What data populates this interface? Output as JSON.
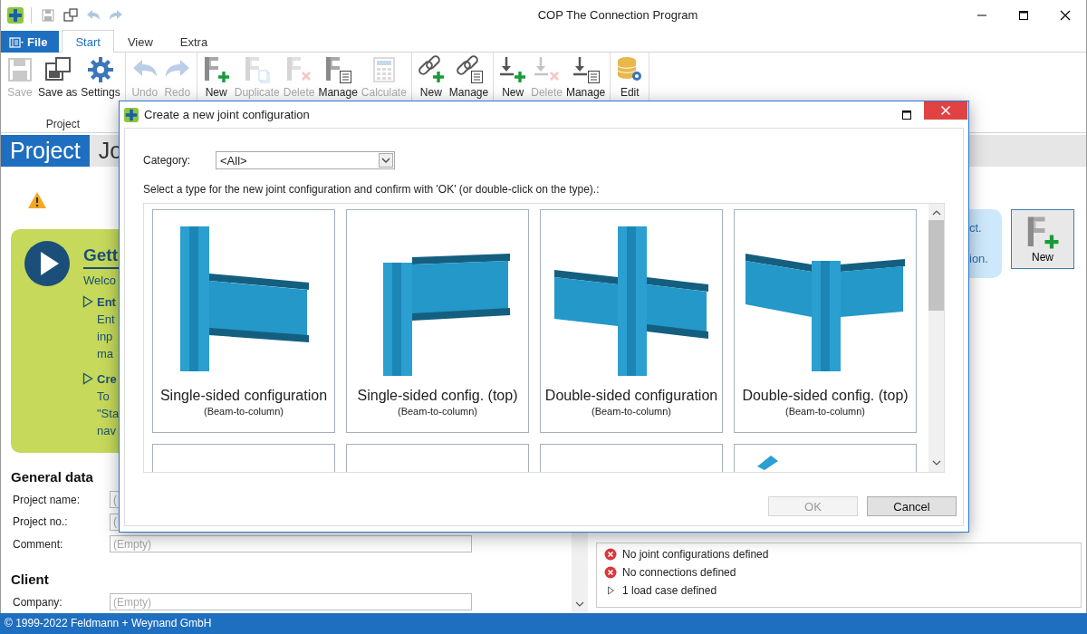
{
  "window": {
    "title": "COP The Connection Program"
  },
  "quick_access": [
    {
      "kind": "save",
      "disabled": true
    },
    {
      "kind": "save_as",
      "disabled": false
    },
    {
      "kind": "undo",
      "disabled": true
    },
    {
      "kind": "redo",
      "disabled": true
    }
  ],
  "menu_tabs": [
    {
      "label": "File",
      "kind": "file",
      "selected": false
    },
    {
      "label": "Start",
      "kind": "tab",
      "selected": true
    },
    {
      "label": "View",
      "kind": "tab",
      "selected": false
    },
    {
      "label": "Extra",
      "kind": "tab",
      "selected": false
    }
  ],
  "ribbon": {
    "groups": [
      {
        "label": "Project",
        "buttons": [
          {
            "label": "Save",
            "kind": "save",
            "disabled": true
          },
          {
            "label": "Save as",
            "kind": "save_as",
            "disabled": false
          },
          {
            "label": "Settings",
            "kind": "gear",
            "disabled": false
          }
        ]
      },
      {
        "buttons": [
          {
            "label": "Undo",
            "kind": "undo",
            "disabled": true
          },
          {
            "label": "Redo",
            "kind": "redo",
            "disabled": true
          }
        ]
      },
      {
        "buttons": [
          {
            "label": "New",
            "kind": "joint_new",
            "disabled": false
          },
          {
            "label": "Duplicate",
            "kind": "joint_dup",
            "disabled": true
          },
          {
            "label": "Delete",
            "kind": "joint_del",
            "disabled": true
          },
          {
            "label": "Manage",
            "kind": "joint_manage",
            "disabled": false
          },
          {
            "label": "Calculate",
            "kind": "calc",
            "disabled": true
          }
        ]
      },
      {
        "buttons": [
          {
            "label": "New",
            "kind": "link_new",
            "disabled": false
          },
          {
            "label": "Manage",
            "kind": "link_manage",
            "disabled": false
          }
        ]
      },
      {
        "buttons": [
          {
            "label": "New",
            "kind": "load_new",
            "disabled": false
          },
          {
            "label": "Delete",
            "kind": "load_del",
            "disabled": true
          },
          {
            "label": "Manage",
            "kind": "load_manage",
            "disabled": false
          }
        ]
      },
      {
        "buttons": [
          {
            "label": "Edit",
            "kind": "database",
            "disabled": false
          }
        ]
      }
    ]
  },
  "page_tabs": [
    {
      "label": "Project",
      "selected": true
    },
    {
      "label": "Jo",
      "selected": false
    }
  ],
  "getting_started": {
    "title": "Gett",
    "intro": "Welco",
    "items": [
      {
        "heading": "Ent",
        "lines": [
          "Ent",
          "inp",
          "ma"
        ]
      },
      {
        "heading": "Cre",
        "lines": [
          "To",
          "\"Sta",
          "nav"
        ]
      }
    ]
  },
  "general_data": {
    "title": "General data",
    "fields": [
      {
        "label": "Project name:",
        "placeholder": "("
      },
      {
        "label": "Project no.:",
        "placeholder": "("
      },
      {
        "label": "Comment:",
        "placeholder": "(Empty)"
      }
    ]
  },
  "client": {
    "title": "Client",
    "fields": [
      {
        "label": "Company:",
        "placeholder": "(Empty)"
      }
    ]
  },
  "info_card": {
    "lines": [
      "ct.",
      "ion."
    ]
  },
  "new_button": {
    "label": "New"
  },
  "project_status": {
    "items": [
      {
        "kind": "error",
        "text": "No joint configurations defined"
      },
      {
        "kind": "error",
        "text": "No connections defined"
      },
      {
        "kind": "expander",
        "text": "1 load case defined"
      }
    ]
  },
  "status_bar": {
    "text": "© 1999-2022 Feldmann + Weynand GmbH"
  },
  "dialog": {
    "title": "Create a new joint configuration",
    "category_label": "Category:",
    "category_value": "<All>",
    "instruction": "Select a type for the new joint configuration and confirm with 'OK' (or double-click on the type).:",
    "types": [
      {
        "kind": "single",
        "title": "Single-sided configuration",
        "subtitle": "(Beam-to-column)",
        "selected": false
      },
      {
        "kind": "single_top",
        "title": "Single-sided config. (top)",
        "subtitle": "(Beam-to-column)",
        "selected": false
      },
      {
        "kind": "double",
        "title": "Double-sided configuration",
        "subtitle": "(Beam-to-column)",
        "selected": false
      },
      {
        "kind": "double_top",
        "title": "Double-sided config. (top)",
        "subtitle": "(Beam-to-column)",
        "selected": false
      },
      {
        "kind": "blank",
        "selected": false
      },
      {
        "kind": "blank",
        "selected": false
      },
      {
        "kind": "blank",
        "selected": false
      },
      {
        "kind": "partial",
        "selected": false
      }
    ],
    "buttons": [
      {
        "label": "OK",
        "disabled": true
      },
      {
        "label": "Cancel",
        "disabled": false
      }
    ]
  }
}
